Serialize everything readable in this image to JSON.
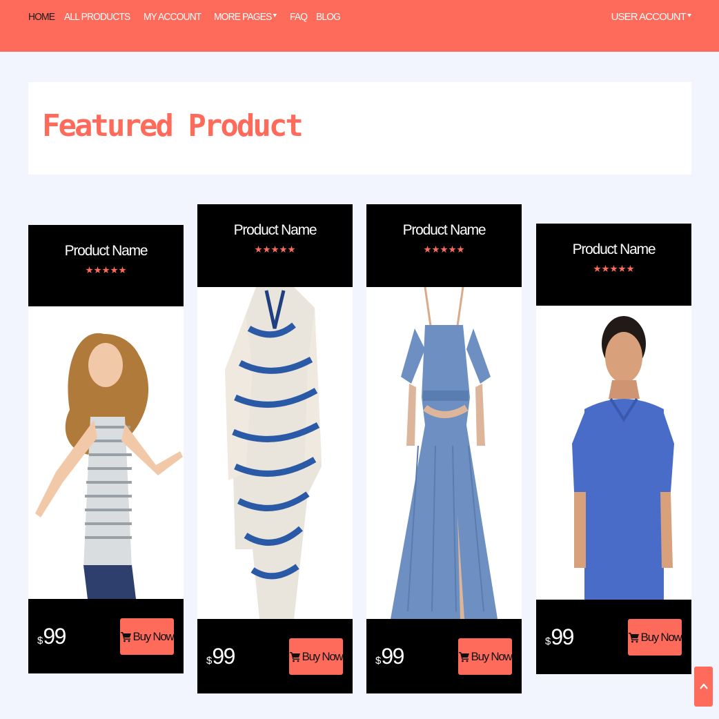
{
  "nav": {
    "links": [
      "HOME",
      "ALL PRODUCTS",
      "MY ACCOUNT",
      "MORE PAGES",
      "FAQ",
      "BLOG"
    ],
    "user_account": "USER ACCOUNT"
  },
  "featured": {
    "title": "Featured Product"
  },
  "products": [
    {
      "name": "Product Name",
      "rating": 5,
      "currency": "$",
      "price": "99",
      "button": "Buy Now",
      "image": "woman-striped-top-hair-flying"
    },
    {
      "name": "Product Name",
      "rating": 5,
      "currency": "$",
      "price": "99",
      "button": "Buy Now",
      "image": "blue-white-tie-dye-kaftan"
    },
    {
      "name": "Product Name",
      "rating": 5,
      "currency": "$",
      "price": "99",
      "button": "Buy Now",
      "image": "blue-cold-shoulder-maxi-dress"
    },
    {
      "name": "Product Name",
      "rating": 5,
      "currency": "$",
      "price": "99",
      "button": "Buy Now",
      "image": "man-blue-polo-shirt"
    }
  ],
  "colors": {
    "accent": "#ff6b5b",
    "background": "#f3f5fe",
    "card": "#000000"
  },
  "icons": {
    "cart": "shopping-cart-icon",
    "star": "star-icon",
    "scroll_top": "chevron-up-icon",
    "caret": "caret-down-icon"
  }
}
